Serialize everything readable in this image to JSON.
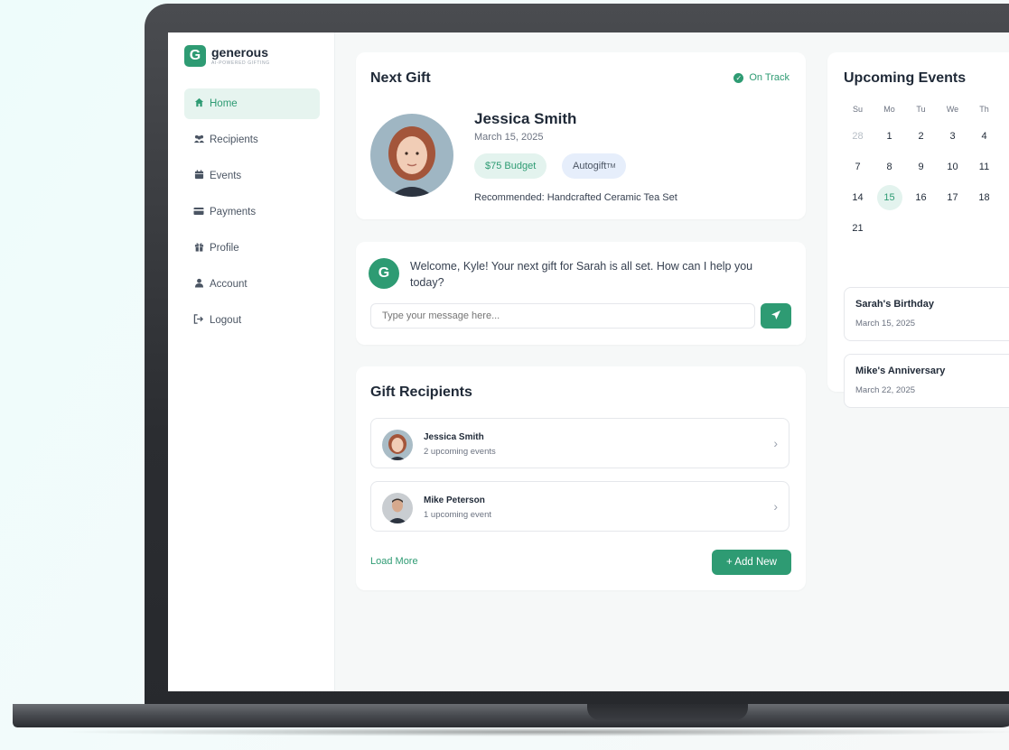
{
  "brand": {
    "name": "generous",
    "tagline": "AI-POWERED GIFTING"
  },
  "sidebar": {
    "items": [
      {
        "label": "Home",
        "icon": "home-icon"
      },
      {
        "label": "Recipients",
        "icon": "users-icon"
      },
      {
        "label": "Events",
        "icon": "calendar-icon"
      },
      {
        "label": "Payments",
        "icon": "credit-card-icon"
      },
      {
        "label": "Profile",
        "icon": "gift-icon"
      },
      {
        "label": "Account",
        "icon": "user-icon"
      },
      {
        "label": "Logout",
        "icon": "logout-icon"
      }
    ]
  },
  "next_gift": {
    "title": "Next Gift",
    "status": "On Track",
    "recipient_name": "Jessica Smith",
    "date": "March 15, 2025",
    "budget": "$75 Budget",
    "autogift": "Autogift",
    "autogift_tm": "TM",
    "recommended": "Recommended: Handcrafted Ceramic Tea Set"
  },
  "chat": {
    "message": "Welcome, Kyle! Your next gift for Sarah is all set. How can I help you today?",
    "placeholder": "Type your message here..."
  },
  "recipients": {
    "title": "Gift Recipients",
    "items": [
      {
        "name": "Jessica Smith",
        "sub": "2 upcoming events"
      },
      {
        "name": "Mike Peterson",
        "sub": "1 upcoming event"
      }
    ],
    "load_more": "Load More",
    "add_new": "+ Add New"
  },
  "events": {
    "title": "Upcoming Events",
    "weekdays": [
      "Su",
      "Mo",
      "Tu",
      "We",
      "Th"
    ],
    "weeks": [
      [
        "28",
        "1",
        "2",
        "3",
        "4"
      ],
      [
        "7",
        "8",
        "9",
        "10",
        "11"
      ],
      [
        "14",
        "15",
        "16",
        "17",
        "18"
      ],
      [
        "21"
      ]
    ],
    "today": "15",
    "items": [
      {
        "title": "Sarah's Birthday",
        "date": "March 15, 2025"
      },
      {
        "title": "Mike's Anniversary",
        "date": "March 22, 2025"
      }
    ]
  },
  "colors": {
    "accent": "#2e9b73",
    "accent_light": "#e3f3ee",
    "autogift_pill": "#e6eefb"
  }
}
